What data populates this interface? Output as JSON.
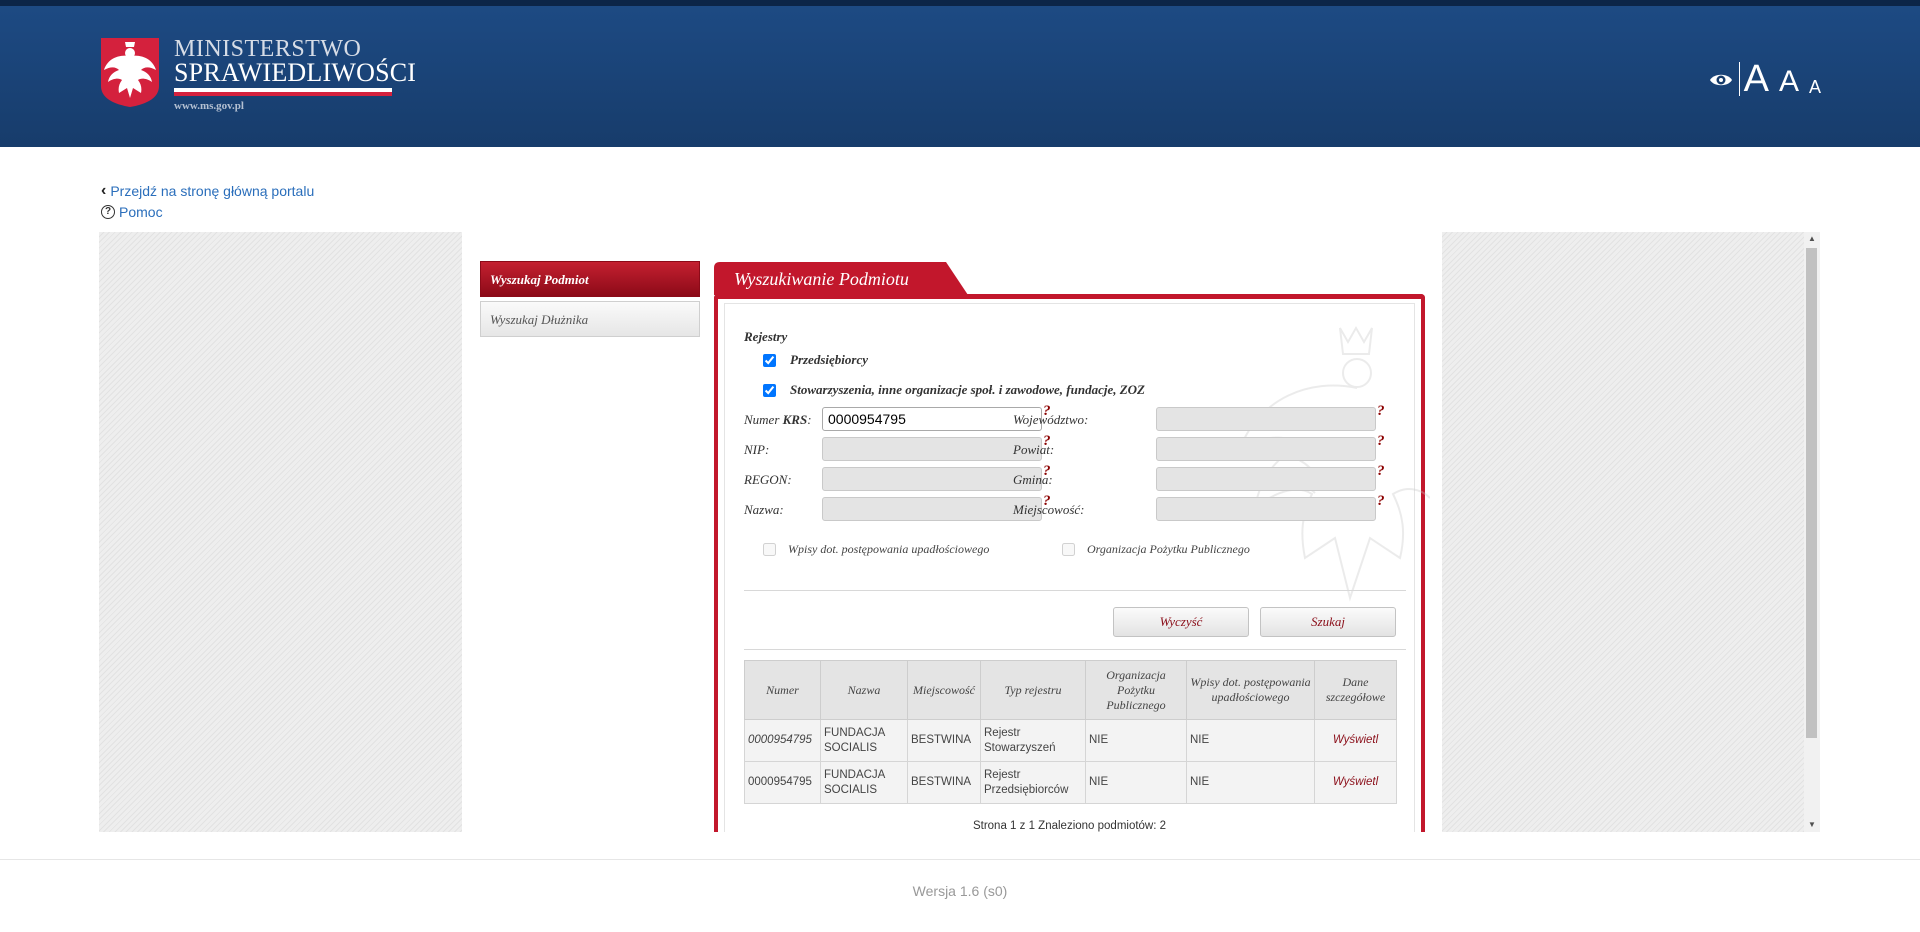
{
  "header": {
    "logo_line1": "MINISTERSTWO",
    "logo_line2": "SPRAWIEDLIWOŚCI",
    "logo_url": "www.ms.gov.pl",
    "font_large": "A",
    "font_medium": "A",
    "font_small": "A",
    "contrast_icon": "eye-icon"
  },
  "links": {
    "home": "Przejdź na stronę główną portalu",
    "help": "Pomoc"
  },
  "sidenav": {
    "items": [
      {
        "label": "Wyszukaj Podmiot",
        "active": true
      },
      {
        "label": "Wyszukaj Dłużnika",
        "active": false
      }
    ]
  },
  "panel": {
    "title": "Wyszukiwanie Podmiotu",
    "registries_label": "Rejestry",
    "registries": [
      {
        "label": "Przedsiębiorcy",
        "checked": true
      },
      {
        "label": "Stowarzyszenia, inne organizacje społ. i zawodowe, fundacje, ZOZ",
        "checked": true
      }
    ],
    "fields_left": [
      {
        "label_prefix": "Numer ",
        "label_bold": "KRS",
        "label_suffix": ":",
        "value": "0000954795",
        "enabled": true
      },
      {
        "label_prefix": "NIP:",
        "label_bold": "",
        "label_suffix": "",
        "value": "",
        "enabled": false
      },
      {
        "label_prefix": "REGON:",
        "label_bold": "",
        "label_suffix": "",
        "value": "",
        "enabled": false
      },
      {
        "label_prefix": "Nazwa:",
        "label_bold": "",
        "label_suffix": "",
        "value": "",
        "enabled": false
      }
    ],
    "fields_right": [
      {
        "label": "Województwo:",
        "value": ""
      },
      {
        "label": "Powiat:",
        "value": ""
      },
      {
        "label": "Gmina:",
        "value": ""
      },
      {
        "label": "Miejscowość:",
        "value": ""
      }
    ],
    "help_mark": "?",
    "option_bankruptcy": "Wpisy dot. postępowania upadłościowego",
    "option_opp": "Organizacja Pożytku Publicznego",
    "btn_clear": "Wyczyść",
    "btn_search": "Szukaj"
  },
  "results": {
    "columns": [
      "Numer",
      "Nazwa",
      "Miejscowość",
      "Typ rejestru",
      "Organizacja Pożytku Publicznego",
      "Wpisy dot. postępowania upadłościowego",
      "Dane szczegółowe"
    ],
    "rows": [
      {
        "numer": "0000954795",
        "nazwa": "FUNDACJA SOCIALIS",
        "miejscowosc": "BESTWINA",
        "typ": "Rejestr Stowarzyszeń",
        "opp": "NIE",
        "upadlosc": "NIE",
        "link": "Wyświetl"
      },
      {
        "numer": "0000954795",
        "nazwa": "FUNDACJA SOCIALIS",
        "miejscowosc": "BESTWINA",
        "typ": "Rejestr Przedsiębiorców",
        "opp": "NIE",
        "upadlosc": "NIE",
        "link": "Wyświetl"
      }
    ],
    "pager": "Strona 1 z 1 Znaleziono podmiotów: 2"
  },
  "footer": {
    "version": "Wersja 1.6 (s0)"
  },
  "colors": {
    "header_bg": "#173c6b",
    "accent_red": "#c2172c",
    "link_blue": "#2a6ebb"
  }
}
